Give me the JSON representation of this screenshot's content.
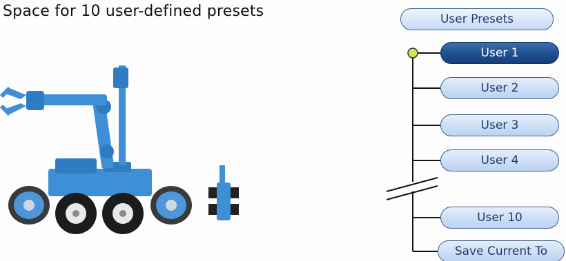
{
  "heading": "Space for 10 user-defined presets",
  "presets_panel": {
    "header_label": "User Presets",
    "items": [
      {
        "label": "User 1",
        "selected": true
      },
      {
        "label": "User 2",
        "selected": false
      },
      {
        "label": "User 3",
        "selected": false
      },
      {
        "label": "User 4",
        "selected": false
      },
      {
        "label": "User 10",
        "selected": false
      }
    ],
    "save_label": "Save Current To"
  },
  "colors": {
    "robot_blue": "#3f8fd6",
    "selected_pill": "#1f4f8f",
    "pill_fill": "#cfe0f6",
    "connector_dot": "#d6e05a"
  }
}
